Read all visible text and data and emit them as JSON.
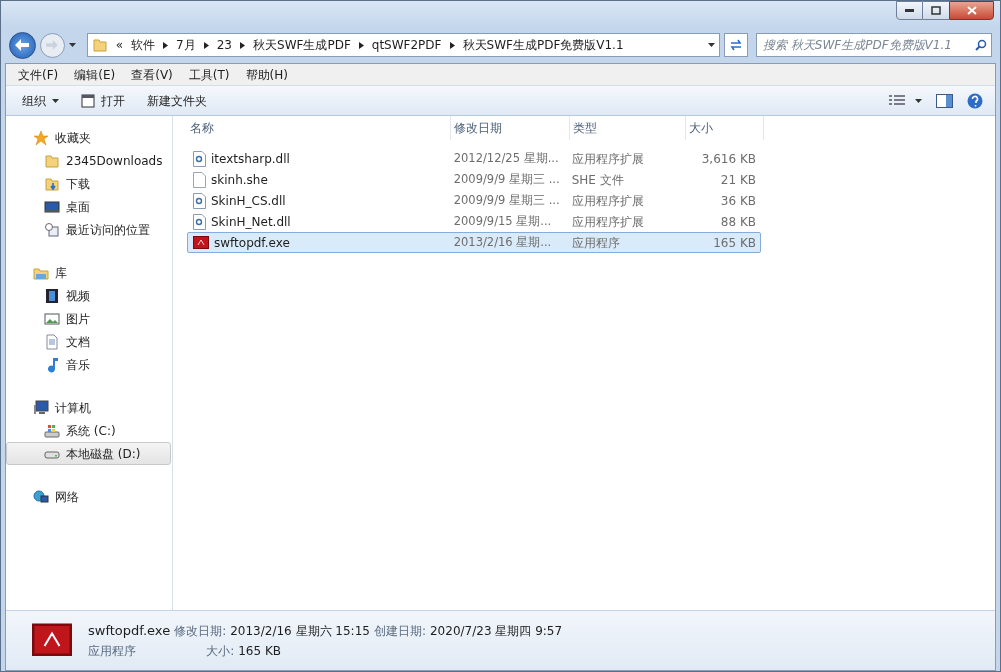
{
  "address": {
    "overflow": "«",
    "segments": [
      "软件",
      "7月",
      "23",
      "秋天SWF生成PDF",
      "qtSWF2PDF",
      "秋天SWF生成PDF免费版V1.1"
    ]
  },
  "search": {
    "placeholder": "搜索 秋天SWF生成PDF免费版V1.1"
  },
  "menu": [
    "文件(F)",
    "编辑(E)",
    "查看(V)",
    "工具(T)",
    "帮助(H)"
  ],
  "toolbar": [
    {
      "kind": "dropdown",
      "label": "组织"
    },
    {
      "kind": "open",
      "label": "打开"
    },
    {
      "kind": "plain",
      "label": "新建文件夹"
    }
  ],
  "sidebar": [
    {
      "label": "收藏夹",
      "kind": "star",
      "children": [
        {
          "label": "2345Downloads",
          "kind": "folder",
          "selected": false
        },
        {
          "label": "下载",
          "kind": "download",
          "selected": false
        },
        {
          "label": "桌面",
          "kind": "desktop",
          "selected": false
        },
        {
          "label": "最近访问的位置",
          "kind": "recent",
          "selected": false
        }
      ]
    },
    {
      "label": "库",
      "kind": "library",
      "children": [
        {
          "label": "视频",
          "kind": "video",
          "selected": false
        },
        {
          "label": "图片",
          "kind": "picture",
          "selected": false
        },
        {
          "label": "文档",
          "kind": "document",
          "selected": false
        },
        {
          "label": "音乐",
          "kind": "music",
          "selected": false
        }
      ]
    },
    {
      "label": "计算机",
      "kind": "computer",
      "children": [
        {
          "label": "系统 (C:)",
          "kind": "sysdrive",
          "selected": false
        },
        {
          "label": "本地磁盘 (D:)",
          "kind": "drive",
          "selected": true
        }
      ]
    },
    {
      "label": "网络",
      "kind": "network"
    }
  ],
  "table": {
    "columns": [
      "名称",
      "修改日期",
      "类型",
      "大小"
    ],
    "rows": [
      {
        "kind": "dll",
        "name": "itextsharp.dll",
        "date": "2012/12/25 星期...",
        "type": "应用程序扩展",
        "size": "3,616 KB",
        "selected": false
      },
      {
        "kind": "file",
        "name": "skinh.she",
        "date": "2009/9/9 星期三 ...",
        "type": "SHE 文件",
        "size": "21 KB",
        "selected": false
      },
      {
        "kind": "dll",
        "name": "SkinH_CS.dll",
        "date": "2009/9/9 星期三 ...",
        "type": "应用程序扩展",
        "size": "36 KB",
        "selected": false
      },
      {
        "kind": "dll",
        "name": "SkinH_Net.dll",
        "date": "2009/9/15 星期...",
        "type": "应用程序扩展",
        "size": "88 KB",
        "selected": false
      },
      {
        "kind": "exe",
        "name": "swftopdf.exe",
        "date": "2013/2/16 星期...",
        "type": "应用程序",
        "size": "165 KB",
        "selected": true
      }
    ]
  },
  "details": {
    "name": "swftopdf.exe",
    "type": "应用程序",
    "modified_label": "修改日期:",
    "modified": "2013/2/16 星期六 15:15",
    "created_label": "创建日期:",
    "created": "2020/7/23 星期四 9:57",
    "size_label": "大小:",
    "size": "165 KB"
  }
}
